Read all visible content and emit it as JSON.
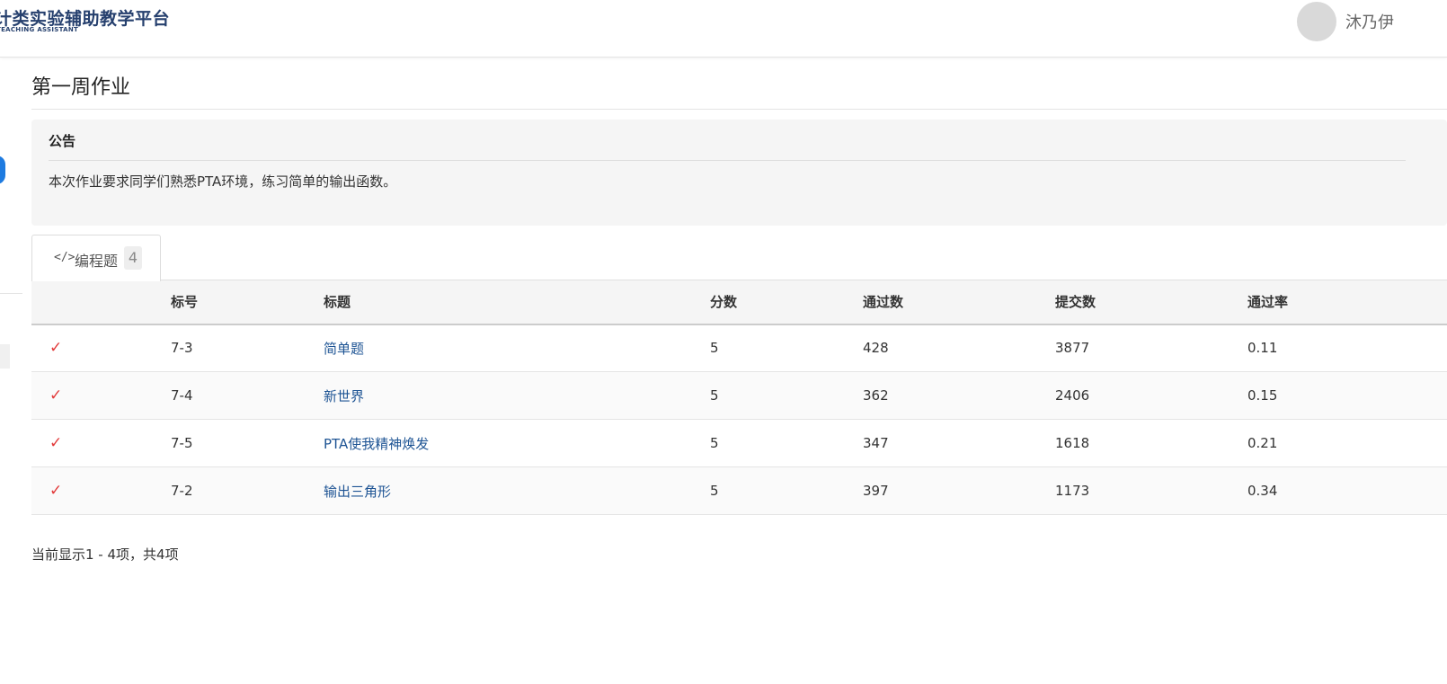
{
  "header": {
    "logo_title": "计类实验辅助教学平台",
    "logo_subtitle": "TEACHING ASSISTANT",
    "username": "沐乃伊",
    "brand_color": "#26406e"
  },
  "page": {
    "title": "第一周作业"
  },
  "notice": {
    "title": "公告",
    "body": "本次作业要求同学们熟悉PTA环境，练习简单的输出函数。"
  },
  "tabs": [
    {
      "icon": "code-icon",
      "icon_glyph": "</>",
      "label": "编程题",
      "count": "4"
    }
  ],
  "table": {
    "columns": [
      "",
      "标号",
      "标题",
      "分数",
      "通过数",
      "提交数",
      "通过率"
    ],
    "rows": [
      {
        "status": "✓",
        "id": "7-3",
        "title": "简单题",
        "score": "5",
        "passed": "428",
        "submitted": "3877",
        "rate": "0.11"
      },
      {
        "status": "✓",
        "id": "7-4",
        "title": "新世界",
        "score": "5",
        "passed": "362",
        "submitted": "2406",
        "rate": "0.15"
      },
      {
        "status": "✓",
        "id": "7-5",
        "title": "PTA使我精神焕发",
        "score": "5",
        "passed": "347",
        "submitted": "1618",
        "rate": "0.21"
      },
      {
        "status": "✓",
        "id": "7-2",
        "title": "输出三角形",
        "score": "5",
        "passed": "397",
        "submitted": "1173",
        "rate": "0.34"
      }
    ]
  },
  "summary": "当前显示1 - 4项，共4项",
  "colors": {
    "link": "#1e5494",
    "check": "#e23b3b",
    "accent_blue": "#1e7be0"
  }
}
